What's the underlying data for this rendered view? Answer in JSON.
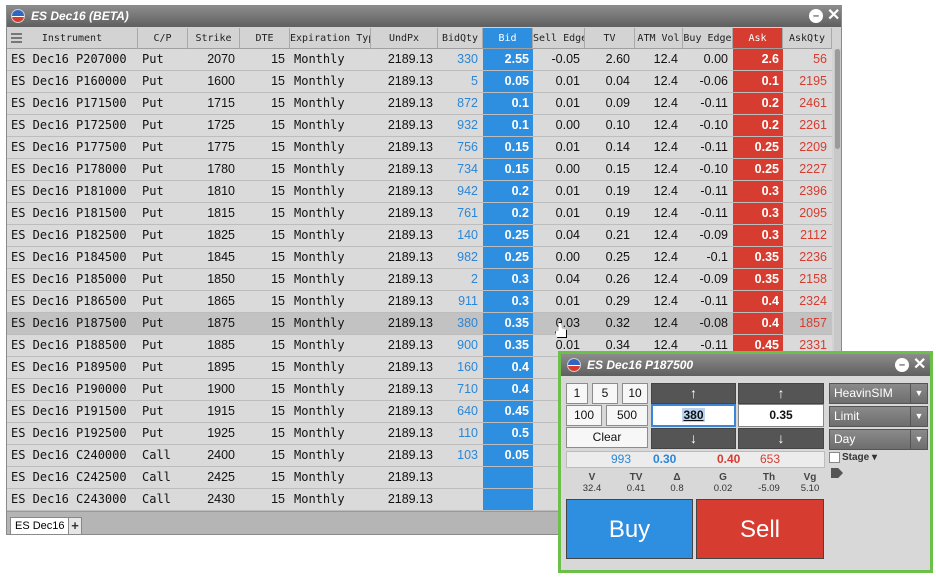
{
  "window": {
    "title": "ES Dec16 (BETA)"
  },
  "columns": [
    "Instrument",
    "C/P",
    "Strike",
    "DTE",
    "Expiration Typ",
    "UndPx",
    "BidQty",
    "Bid",
    "Sell Edge",
    "TV",
    "ATM Vol",
    "Buy Edge",
    "Ask",
    "AskQty"
  ],
  "rows": [
    [
      "ES Dec16 P207000",
      "Put",
      "2070",
      "15",
      "Monthly",
      "2189.13",
      "330",
      "2.55",
      "-0.05",
      "2.60",
      "12.4",
      "0.00",
      "2.6",
      "56"
    ],
    [
      "ES Dec16 P160000",
      "Put",
      "1600",
      "15",
      "Monthly",
      "2189.13",
      "5",
      "0.05",
      "0.01",
      "0.04",
      "12.4",
      "-0.06",
      "0.1",
      "2195"
    ],
    [
      "ES Dec16 P171500",
      "Put",
      "1715",
      "15",
      "Monthly",
      "2189.13",
      "872",
      "0.1",
      "0.01",
      "0.09",
      "12.4",
      "-0.11",
      "0.2",
      "2461"
    ],
    [
      "ES Dec16 P172500",
      "Put",
      "1725",
      "15",
      "Monthly",
      "2189.13",
      "932",
      "0.1",
      "0.00",
      "0.10",
      "12.4",
      "-0.10",
      "0.2",
      "2261"
    ],
    [
      "ES Dec16 P177500",
      "Put",
      "1775",
      "15",
      "Monthly",
      "2189.13",
      "756",
      "0.15",
      "0.01",
      "0.14",
      "12.4",
      "-0.11",
      "0.25",
      "2209"
    ],
    [
      "ES Dec16 P178000",
      "Put",
      "1780",
      "15",
      "Monthly",
      "2189.13",
      "734",
      "0.15",
      "0.00",
      "0.15",
      "12.4",
      "-0.10",
      "0.25",
      "2227"
    ],
    [
      "ES Dec16 P181000",
      "Put",
      "1810",
      "15",
      "Monthly",
      "2189.13",
      "942",
      "0.2",
      "0.01",
      "0.19",
      "12.4",
      "-0.11",
      "0.3",
      "2396"
    ],
    [
      "ES Dec16 P181500",
      "Put",
      "1815",
      "15",
      "Monthly",
      "2189.13",
      "761",
      "0.2",
      "0.01",
      "0.19",
      "12.4",
      "-0.11",
      "0.3",
      "2095"
    ],
    [
      "ES Dec16 P182500",
      "Put",
      "1825",
      "15",
      "Monthly",
      "2189.13",
      "140",
      "0.25",
      "0.04",
      "0.21",
      "12.4",
      "-0.09",
      "0.3",
      "2112"
    ],
    [
      "ES Dec16 P184500",
      "Put",
      "1845",
      "15",
      "Monthly",
      "2189.13",
      "982",
      "0.25",
      "0.00",
      "0.25",
      "12.4",
      "-0.1",
      "0.35",
      "2236"
    ],
    [
      "ES Dec16 P185000",
      "Put",
      "1850",
      "15",
      "Monthly",
      "2189.13",
      "2",
      "0.3",
      "0.04",
      "0.26",
      "12.4",
      "-0.09",
      "0.35",
      "2158"
    ],
    [
      "ES Dec16 P186500",
      "Put",
      "1865",
      "15",
      "Monthly",
      "2189.13",
      "911",
      "0.3",
      "0.01",
      "0.29",
      "12.4",
      "-0.11",
      "0.4",
      "2324"
    ],
    [
      "ES Dec16 P187500",
      "Put",
      "1875",
      "15",
      "Monthly",
      "2189.13",
      "380",
      "0.35",
      "0.03",
      "0.32",
      "12.4",
      "-0.08",
      "0.4",
      "1857"
    ],
    [
      "ES Dec16 P188500",
      "Put",
      "1885",
      "15",
      "Monthly",
      "2189.13",
      "900",
      "0.35",
      "0.01",
      "0.34",
      "12.4",
      "-0.11",
      "0.45",
      "2331"
    ],
    [
      "ES Dec16 P189500",
      "Put",
      "1895",
      "15",
      "Monthly",
      "2189.13",
      "160",
      "0.4",
      "0",
      "",
      "",
      "",
      "",
      ""
    ],
    [
      "ES Dec16 P190000",
      "Put",
      "1900",
      "15",
      "Monthly",
      "2189.13",
      "710",
      "0.4",
      "0",
      "",
      "",
      "",
      "",
      ""
    ],
    [
      "ES Dec16 P191500",
      "Put",
      "1915",
      "15",
      "Monthly",
      "2189.13",
      "640",
      "0.45",
      "0",
      "",
      "",
      "",
      "",
      ""
    ],
    [
      "ES Dec16 P192500",
      "Put",
      "1925",
      "15",
      "Monthly",
      "2189.13",
      "110",
      "0.5",
      "0",
      "",
      "",
      "",
      "",
      ""
    ],
    [
      "ES Dec16 C240000",
      "Call",
      "2400",
      "15",
      "Monthly",
      "2189.13",
      "103",
      "0.05",
      "-0",
      "",
      "",
      "",
      "",
      ""
    ],
    [
      "ES Dec16 C242500",
      "Call",
      "2425",
      "15",
      "Monthly",
      "2189.13",
      "",
      "",
      "",
      "",
      "",
      "",
      "",
      ""
    ],
    [
      "ES Dec16 C243000",
      "Call",
      "2430",
      "15",
      "Monthly",
      "2189.13",
      "",
      "",
      "",
      "",
      "",
      "",
      "",
      ""
    ]
  ],
  "selected_row": 12,
  "footer": {
    "tab_label": "ES Dec16",
    "add_tab": "+"
  },
  "ticket": {
    "title": "ES Dec16 P187500",
    "qty_buttons": [
      "1",
      "5",
      "10",
      "100",
      "500"
    ],
    "clear": "Clear",
    "qty_value": "380",
    "price_value": "0.35",
    "account": "HeavinSIM",
    "order_type": "Limit",
    "tif": "Day",
    "stage": "Stage",
    "market": {
      "bid_qty": "993",
      "bid": "0.30",
      "ask": "0.40",
      "ask_qty": "653"
    },
    "greeks": [
      {
        "name": "V",
        "value": "32.4"
      },
      {
        "name": "TV",
        "value": "0.41"
      },
      {
        "name": "Δ",
        "value": "0.8"
      },
      {
        "name": "G",
        "value": "0.02"
      },
      {
        "name": "Th",
        "value": "-5.09"
      },
      {
        "name": "Vg",
        "value": "5.10"
      }
    ],
    "buy_label": "Buy",
    "sell_label": "Sell"
  },
  "colors": {
    "bid": "#2e8ee0",
    "ask": "#d63c2f",
    "ticket_border": "#6cc04a"
  }
}
